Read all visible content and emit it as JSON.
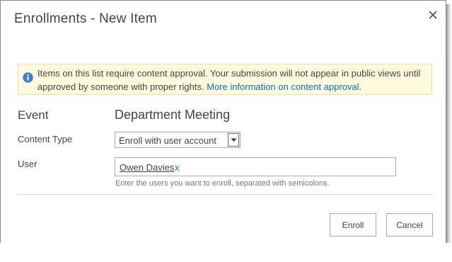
{
  "dialog": {
    "title": "Enrollments - New Item",
    "close_icon": "close-icon"
  },
  "notice": {
    "icon": "info-icon",
    "text": "Items on this list require content approval. Your submission will not appear in public views until approved by someone with proper rights. ",
    "link": "More information on content approval."
  },
  "form": {
    "event": {
      "label": "Event",
      "value": "Department Meeting"
    },
    "content_type": {
      "label": "Content Type",
      "selected": "Enroll with user account"
    },
    "user": {
      "label": "User",
      "selected_user": "Owen Davies",
      "remove_glyph": "x",
      "hint": "Enter the users you want to enroll, separated with semicolons."
    }
  },
  "buttons": {
    "enroll": "Enroll",
    "cancel": "Cancel"
  },
  "colors": {
    "notice_background": "#fff9de",
    "notice_border": "#f0dd9c",
    "link": "#0072c6",
    "info_icon": "#3f7fcc"
  }
}
